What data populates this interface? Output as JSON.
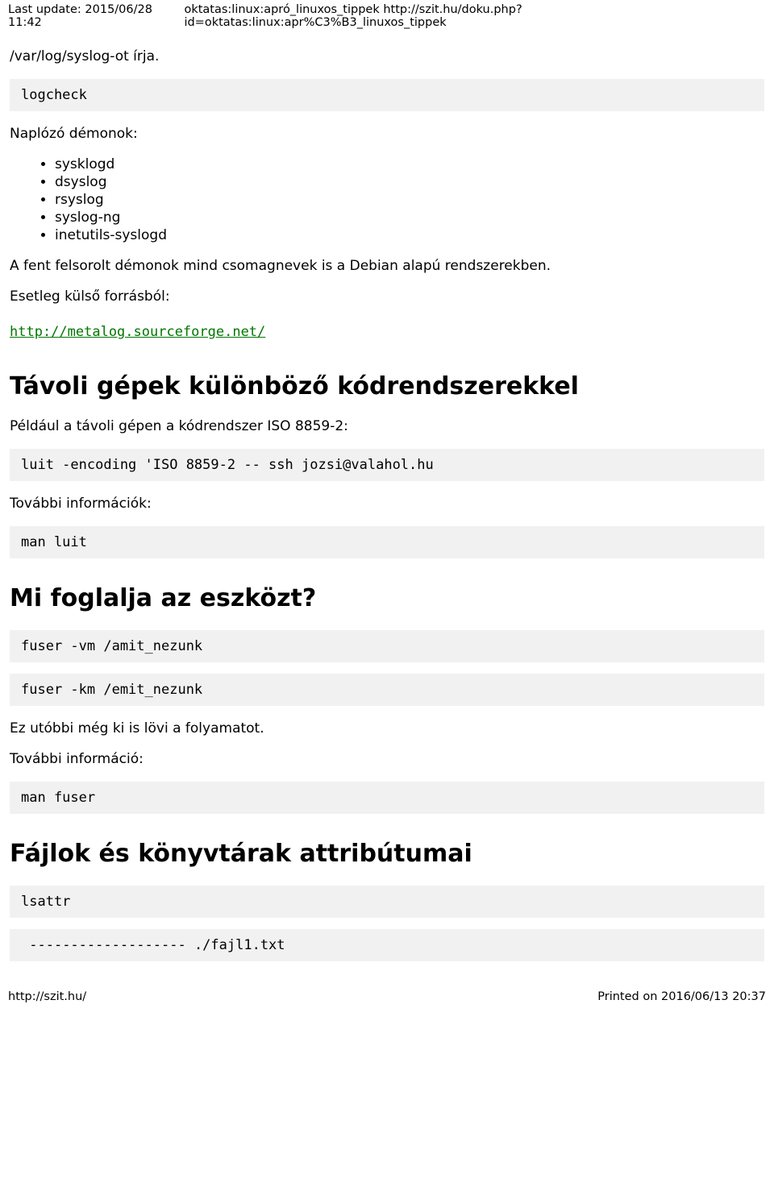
{
  "header": {
    "left": "Last update: 2015/06/28 11:42",
    "right": "oktatas:linux:apró_linuxos_tippek http://szit.hu/doku.php?id=oktatas:linux:apr%C3%B3_linuxos_tippek"
  },
  "body": {
    "p_intro": "/var/log/syslog-ot írja.",
    "code_logcheck": "logcheck",
    "p_naplozo": "Naplózó démonok:",
    "daemons": [
      "sysklogd",
      "dsyslog",
      "rsyslog",
      "syslog-ng",
      "inetutils-syslogd"
    ],
    "p_afent": "A fent felsorolt démonok mind csomagnevek is a Debian alapú rendszerekben.",
    "p_esetleg": "Esetleg külső forrásból:",
    "link_metalog": "http://metalog.sourceforge.net/",
    "h2_tavoli": "Távoli gépek különböző kódrendszerekkel",
    "p_peldaul": "Például a távoli gépen a kódrendszer ISO 8859-2:",
    "code_luit": "luit -encoding 'ISO 8859-2 -- ssh jozsi@valahol.hu",
    "p_tovabbi1": "További információk:",
    "code_manluit": "man luit",
    "h2_mifoglalja": "Mi foglalja az eszközt?",
    "code_fuser1": "fuser -vm /amit_nezunk",
    "code_fuser2": "fuser -km /emit_nezunk",
    "p_ezutobbi": "Ez utóbbi még ki is lövi a folyamatot.",
    "p_tovabbi2": "További információ:",
    "code_manfuser": "man fuser",
    "h2_fajlok": "Fájlok és könyvtárak attribútumai",
    "code_lsattr": "lsattr",
    "code_output": " ------------------- ./fajl1.txt"
  },
  "footer": {
    "left": "http://szit.hu/",
    "right": "Printed on 2016/06/13 20:37"
  }
}
